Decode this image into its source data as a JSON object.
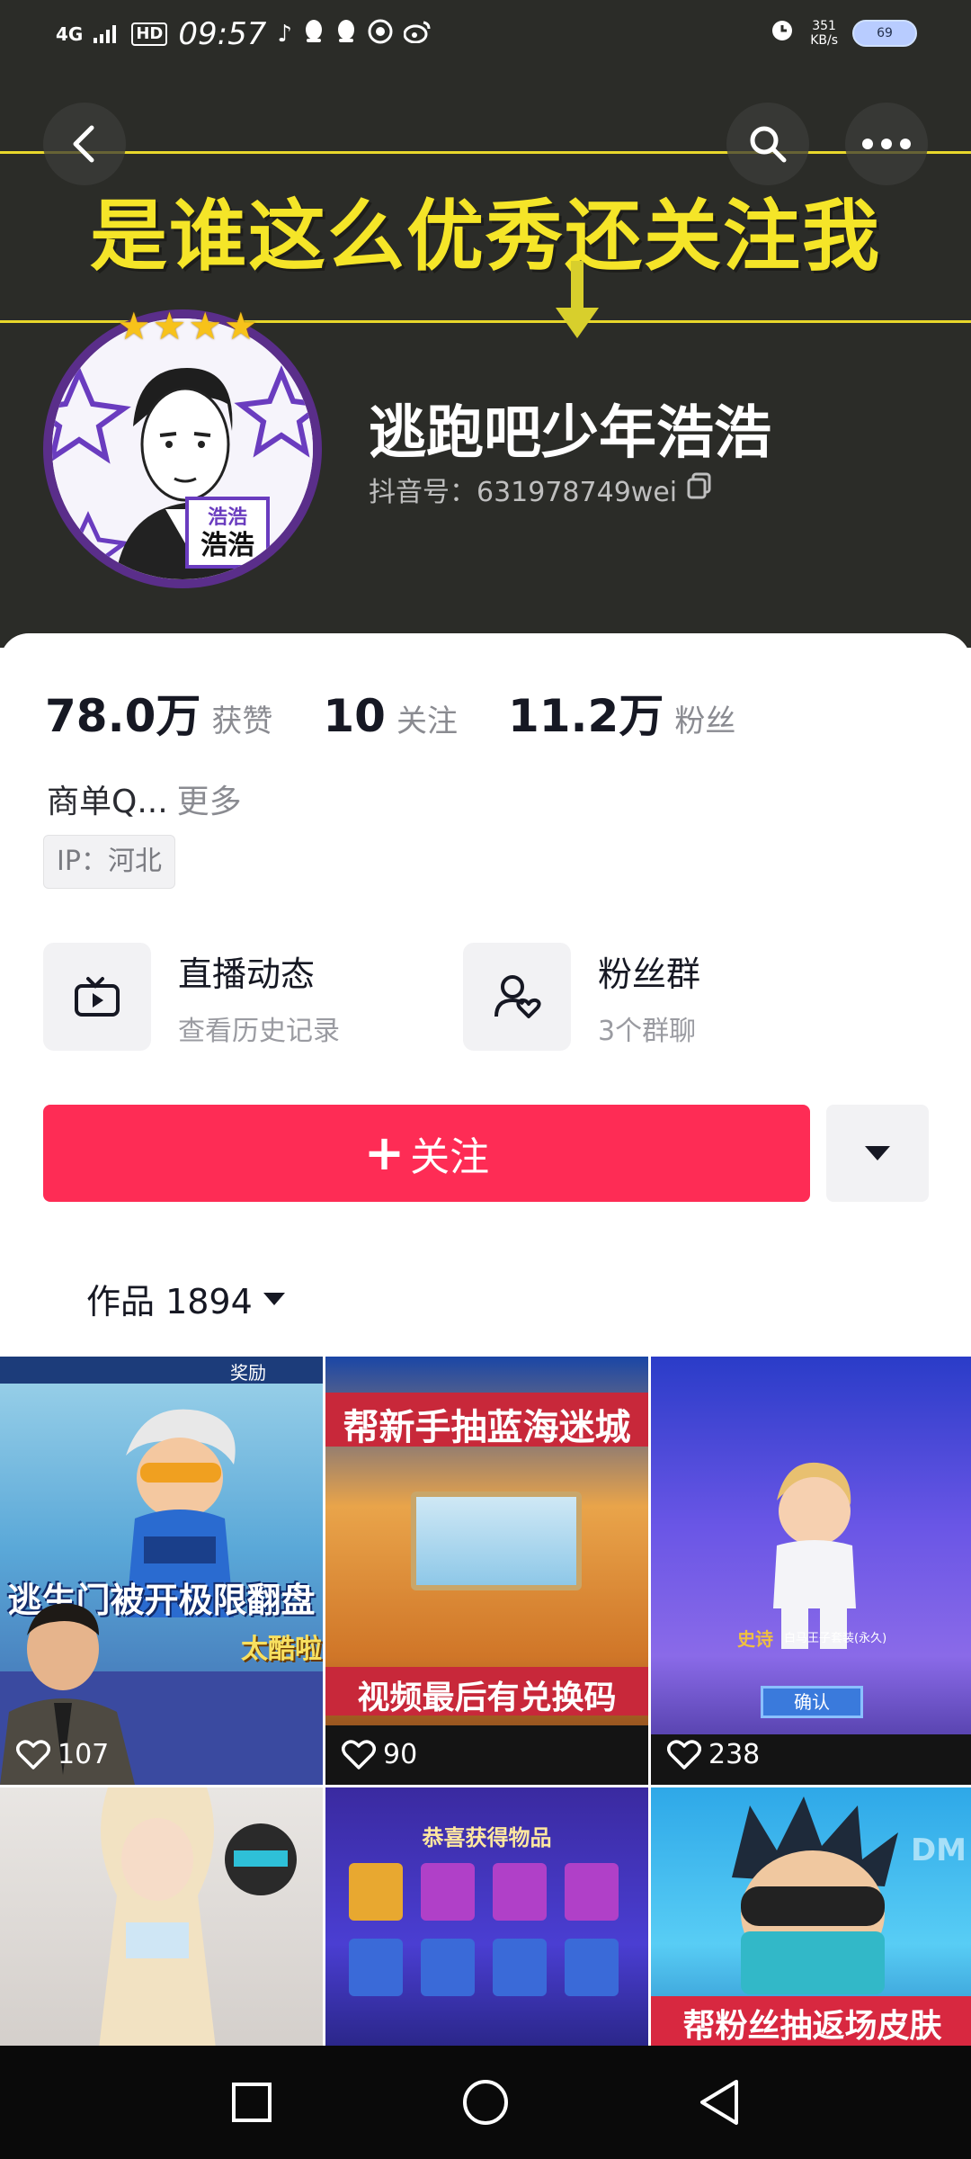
{
  "status_bar": {
    "network": "4G",
    "hd": "HD",
    "time": "09:57",
    "speed": "351",
    "speed_unit": "KB/s",
    "battery": "69"
  },
  "banner": {
    "text": "是谁这么优秀还关注我"
  },
  "avatar": {
    "badge_top": "浩浩",
    "badge_bottom": "浩浩"
  },
  "profile": {
    "nickname": "逃跑吧少年浩浩",
    "douyin_id": "抖音号：631978749wei"
  },
  "stats": [
    {
      "num": "78.0万",
      "label": "获赞"
    },
    {
      "num": "10",
      "label": "关注"
    },
    {
      "num": "11.2万",
      "label": "粉丝"
    }
  ],
  "bio": {
    "text": "商单Q...",
    "more": "更多"
  },
  "ip": "IP：河北",
  "features": {
    "live": {
      "title": "直播动态",
      "subtitle": "查看历史记录"
    },
    "fans": {
      "title": "粉丝群",
      "subtitle": "3个群聊"
    }
  },
  "follow": {
    "plus": "+",
    "label": "关注"
  },
  "works": {
    "label": "作品 1894"
  },
  "videos": [
    {
      "caption": "逃生门被开极限翻盘",
      "caption2": "太酷啦",
      "top": "奖励",
      "likes": "107"
    },
    {
      "caption": "帮新手抽蓝海迷城",
      "caption2": "视频最后有兑换码",
      "top": "",
      "likes": "90"
    },
    {
      "caption": "确认",
      "caption2": "白马王子套装(永久)",
      "top": "史诗",
      "likes": "238"
    },
    {
      "caption": "",
      "caption2": "",
      "top": "",
      "likes": ""
    },
    {
      "caption": "恭喜获得物品",
      "caption2": "",
      "top": "",
      "likes": ""
    },
    {
      "caption": "帮粉丝抽返场皮肤",
      "caption2": "DM",
      "top": "",
      "likes": ""
    }
  ],
  "colors": {
    "accent": "#fe2c55",
    "header_bg": "#2b2c28",
    "banner_yellow": "#f5e528"
  }
}
